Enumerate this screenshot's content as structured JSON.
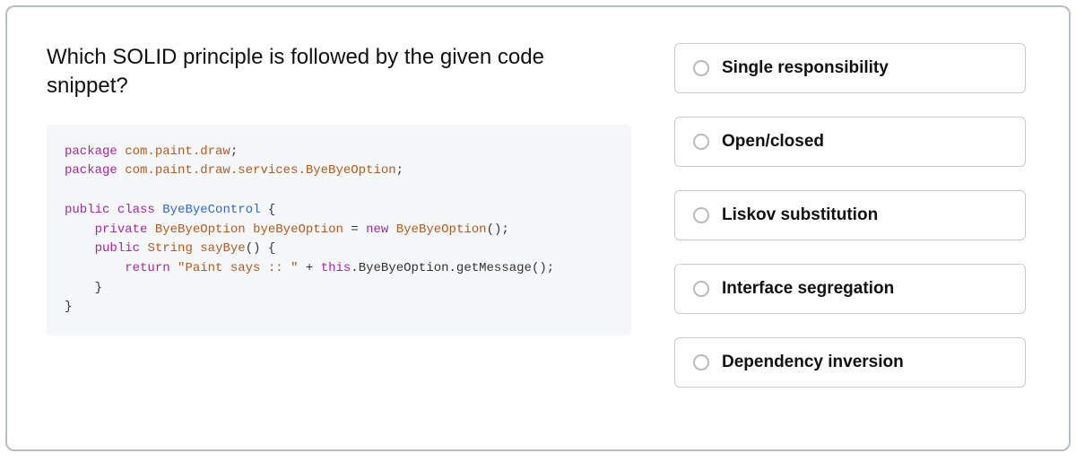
{
  "question": {
    "prompt": "Which SOLID principle is followed by the given code snippet?"
  },
  "code": {
    "line1_kw": "package",
    "line1_pkg": "com.paint.draw",
    "line2_kw": "package",
    "line2_pkg": "com.paint.draw.services.ByeByeOption",
    "cls_kw1": "public",
    "cls_kw2": "class",
    "cls_name": "ByeByeControl",
    "priv_kw": "private",
    "type1": "ByeByeOption",
    "var1": "byeByeOption",
    "new_kw": "new",
    "ctor": "ByeByeOption",
    "pub_kw": "public",
    "ret_type": "String",
    "method": "sayBye",
    "return_kw": "return",
    "str": "\"Paint says :: \"",
    "this_kw": "this",
    "call_chain": ".ByeByeOption.getMessage"
  },
  "options": [
    {
      "label": "Single responsibility"
    },
    {
      "label": "Open/closed"
    },
    {
      "label": "Liskov substitution"
    },
    {
      "label": "Interface segregation"
    },
    {
      "label": "Dependency inversion"
    }
  ]
}
